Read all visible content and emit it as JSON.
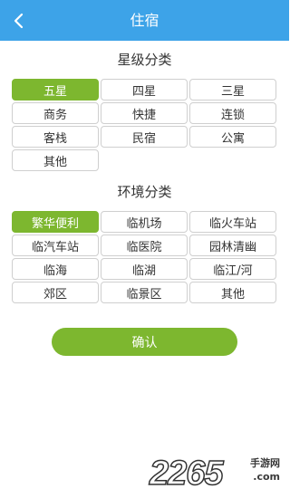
{
  "header": {
    "title": "住宿",
    "back_icon": "chevron-left-icon"
  },
  "star_section": {
    "title": "星级分类",
    "options": [
      {
        "label": "五星",
        "selected": true
      },
      {
        "label": "四星",
        "selected": false
      },
      {
        "label": "三星",
        "selected": false
      },
      {
        "label": "商务",
        "selected": false
      },
      {
        "label": "快捷",
        "selected": false
      },
      {
        "label": "连锁",
        "selected": false
      },
      {
        "label": "客栈",
        "selected": false
      },
      {
        "label": "民宿",
        "selected": false
      },
      {
        "label": "公寓",
        "selected": false
      },
      {
        "label": "其他",
        "selected": false
      }
    ]
  },
  "env_section": {
    "title": "环境分类",
    "options": [
      {
        "label": "繁华便利",
        "selected": true
      },
      {
        "label": "临机场",
        "selected": false
      },
      {
        "label": "临火车站",
        "selected": false
      },
      {
        "label": "临汽车站",
        "selected": false
      },
      {
        "label": "临医院",
        "selected": false
      },
      {
        "label": "园林清幽",
        "selected": false
      },
      {
        "label": "临海",
        "selected": false
      },
      {
        "label": "临湖",
        "selected": false
      },
      {
        "label": "临江/河",
        "selected": false
      },
      {
        "label": "郊区",
        "selected": false
      },
      {
        "label": "临景区",
        "selected": false
      },
      {
        "label": "其他",
        "selected": false
      }
    ]
  },
  "confirm_label": "确认",
  "watermark": {
    "brand": "2265",
    "sub": "手游网",
    "domain": ".com"
  },
  "colors": {
    "header_bg": "#3da3e8",
    "selected_bg": "#7db72f",
    "confirm_bg": "#7db72f"
  }
}
